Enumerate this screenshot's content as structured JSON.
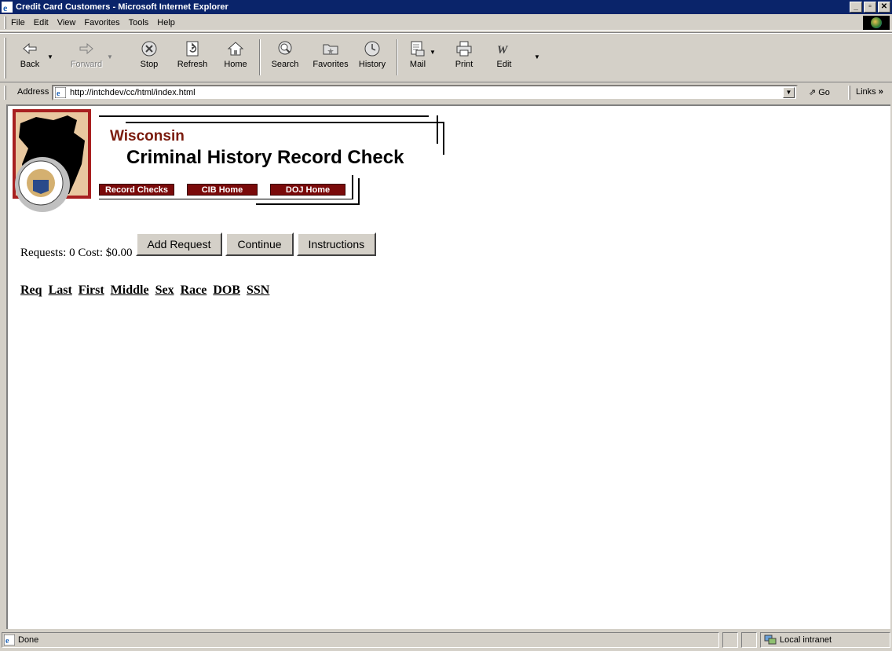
{
  "window": {
    "title": "Credit Card Customers - Microsoft Internet Explorer",
    "min_label": "_",
    "max_label": "▫",
    "close_label": "✕"
  },
  "menu": [
    "File",
    "Edit",
    "View",
    "Favorites",
    "Tools",
    "Help"
  ],
  "toolbar": {
    "back": "Back",
    "forward": "Forward",
    "stop": "Stop",
    "refresh": "Refresh",
    "home": "Home",
    "search": "Search",
    "favorites": "Favorites",
    "history": "History",
    "mail": "Mail",
    "print": "Print",
    "edit": "Edit"
  },
  "address": {
    "label": "Address",
    "url": "http://intchdev/cc/html/index.html",
    "go": "Go",
    "links": "Links"
  },
  "banner": {
    "state": "Wisconsin",
    "title": "Criminal History Record Check",
    "nav": [
      "Record Checks",
      "CIB Home",
      "DOJ Home"
    ]
  },
  "requests": {
    "text": "Requests: 0 Cost: $0.00",
    "buttons": [
      "Add Request",
      "Continue",
      "Instructions"
    ]
  },
  "columns": [
    "Req",
    "Last",
    "First",
    "Middle",
    "Sex",
    "Race",
    "DOB",
    "SSN"
  ],
  "status": {
    "text": "Done",
    "zone": "Local intranet"
  }
}
